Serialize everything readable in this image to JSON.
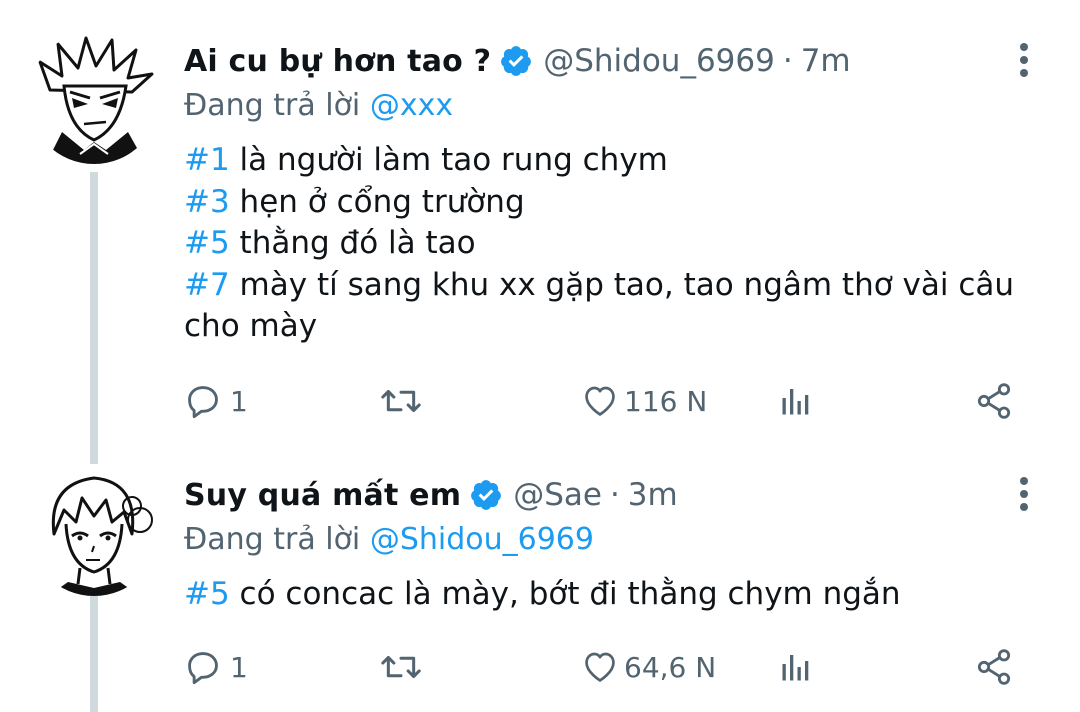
{
  "tweets": [
    {
      "display_name": "Ai cu bự hơn tao ?",
      "handle": "@Shidou_6969",
      "separator": "·",
      "time": "7m",
      "replying_prefix": "Đang trả lời",
      "replying_to": "@xxx",
      "avatar_icon": "anime-spiky-hair-avatar",
      "body_lines": [
        {
          "tag": "#1",
          "text": " là người làm tao rung chym"
        },
        {
          "tag": "#3",
          "text": " hẹn ở cổng trường"
        },
        {
          "tag": "#5",
          "text": " thằng đó là tao"
        },
        {
          "tag": "#7",
          "text": " mày tí sang khu xx gặp tao, tao ngâm thơ vài câu"
        },
        {
          "tag": "",
          "text": "cho mày"
        }
      ],
      "reply_count": "1",
      "like_count": "116 N"
    },
    {
      "display_name": "Suy quá mất em",
      "handle": "@Sae",
      "separator": "·",
      "time": "3m",
      "replying_prefix": "Đang trả lời",
      "replying_to": "@Shidou_6969",
      "avatar_icon": "anime-calm-avatar",
      "body_lines": [
        {
          "tag": "#5",
          "text": " có concac là mày, bớt đi thằng chym ngắn"
        }
      ],
      "reply_count": "1",
      "like_count": "64,6 N"
    }
  ],
  "colors": {
    "accent": "#1d9bf0",
    "secondary_text": "#536471",
    "primary_text": "#0f1419",
    "thread_line": "#cfd9de"
  },
  "icons": [
    "verified-icon",
    "more-icon",
    "reply-icon",
    "retweet-icon",
    "like-icon",
    "views-icon",
    "share-icon"
  ]
}
